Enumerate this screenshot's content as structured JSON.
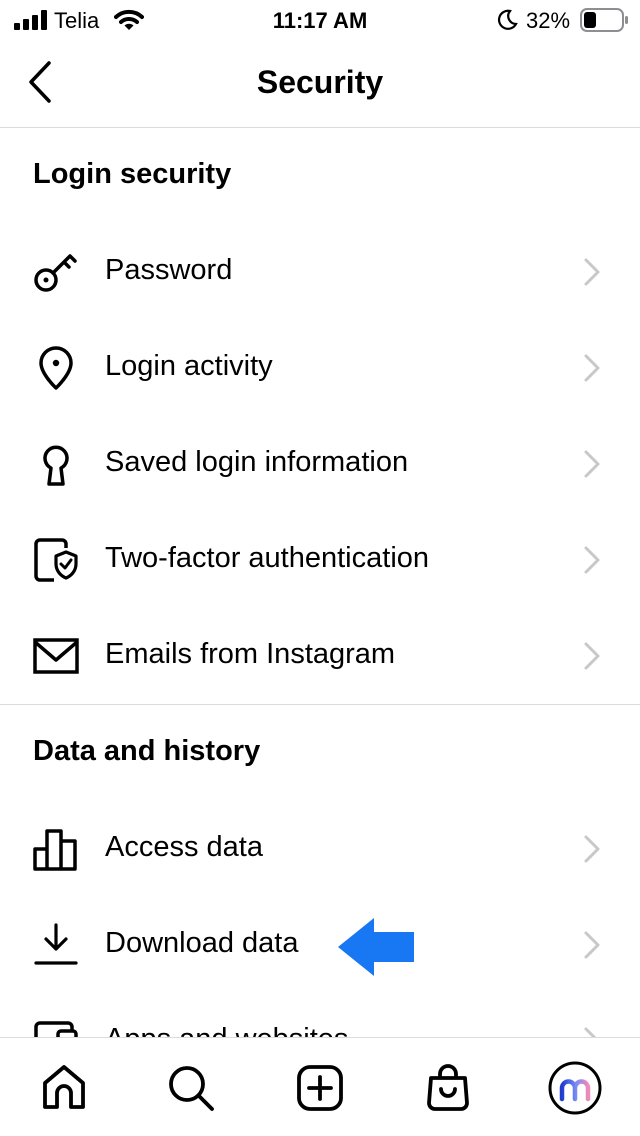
{
  "status_bar": {
    "carrier": "Telia",
    "time": "11:17 AM",
    "battery_percent": "32%",
    "icons": [
      "signal-icon",
      "wifi-icon",
      "moon-icon",
      "battery-icon"
    ]
  },
  "header": {
    "title": "Security",
    "back_icon": "chevron-left-icon"
  },
  "sections": {
    "login_security": {
      "title": "Login security",
      "items": [
        {
          "label": "Password",
          "icon": "key-icon"
        },
        {
          "label": "Login activity",
          "icon": "location-pin-icon"
        },
        {
          "label": "Saved login information",
          "icon": "keyhole-icon"
        },
        {
          "label": "Two-factor authentication",
          "icon": "phone-shield-icon"
        },
        {
          "label": "Emails from Instagram",
          "icon": "envelope-icon"
        }
      ]
    },
    "data_history": {
      "title": "Data and history",
      "items": [
        {
          "label": "Access data",
          "icon": "bar-chart-icon"
        },
        {
          "label": "Download data",
          "icon": "download-icon"
        },
        {
          "label": "Apps and websites",
          "icon": "apps-icon"
        }
      ]
    }
  },
  "annotation": {
    "color": "#1877f2",
    "icon": "arrow-left-icon"
  },
  "tab_bar": {
    "tabs": [
      "home-icon",
      "search-icon",
      "create-icon",
      "shop-icon",
      "profile-avatar"
    ]
  },
  "colors": {
    "divider": "#dbdbdb",
    "chevron": "#c7c7cc",
    "accent_blue": "#1877f2"
  }
}
